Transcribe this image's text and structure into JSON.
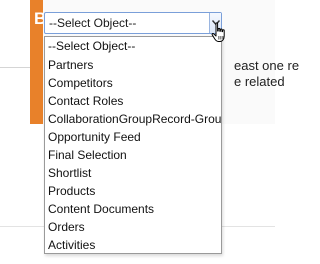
{
  "step": {
    "letter": "B"
  },
  "partial_text": {
    "line1": "east one re",
    "line2": "e related"
  },
  "select": {
    "value": "--Select Object--"
  },
  "dropdown": {
    "options": [
      "--Select Object--",
      "Partners",
      "Competitors",
      "Contact Roles",
      "CollaborationGroupRecord-Group",
      "Opportunity Feed",
      "Final Selection",
      "Shortlist",
      "Products",
      "Content Documents",
      "Orders",
      "Activities"
    ],
    "selected_index": 0
  },
  "icons": {
    "arrow": "chevron-down-icon",
    "cursor": "hand-pointer-icon"
  },
  "colors": {
    "panel_orange": "#e8812a",
    "select_border": "#7a9fd9"
  }
}
